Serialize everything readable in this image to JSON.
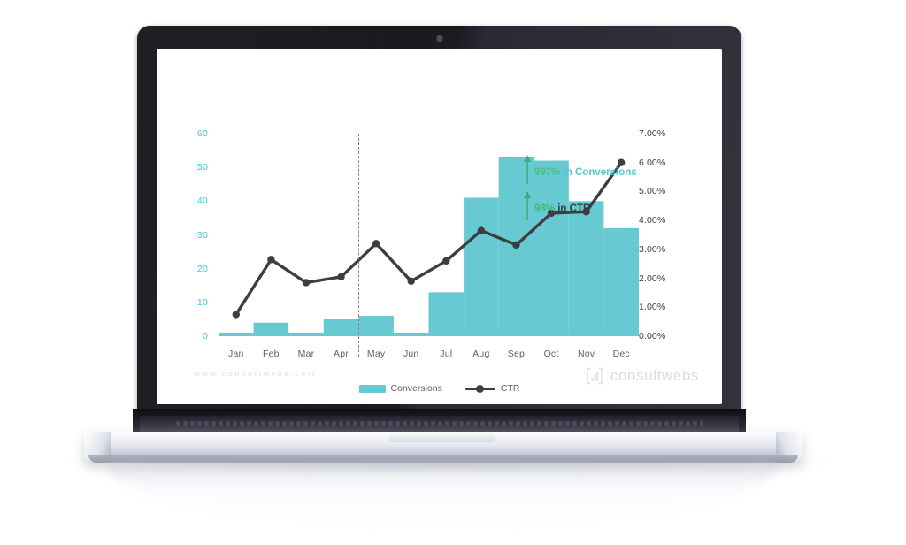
{
  "device": {
    "type": "laptop",
    "webcam": "webcam-dot"
  },
  "screen": {
    "footer_url": "www.consultwebs.com",
    "brand_name": "consultwebs",
    "brand_icon": "bar-chart-logo-icon"
  },
  "annotations": [
    {
      "id": "conversions-callout",
      "icon": "arrow-up-icon",
      "value": "997%",
      "label": "in Conversions",
      "label_color": "#5ac5cf",
      "value_color": "#4cbf7e"
    },
    {
      "id": "ctr-callout",
      "icon": "arrow-up-icon",
      "value": "98%",
      "label": "in CTR",
      "label_color": "#3a3b40",
      "value_color": "#4cbf7e"
    }
  ],
  "chart_data": {
    "type": "bar",
    "title": "",
    "subtitle": "",
    "xlabel": "",
    "ylabel": "",
    "grid": false,
    "legend_position": "bottom",
    "categories": [
      "Jan",
      "Feb",
      "Mar",
      "Apr",
      "May",
      "Jun",
      "Jul",
      "Aug",
      "Sep",
      "Oct",
      "Nov",
      "Dec"
    ],
    "axes": {
      "left": {
        "name": "Conversions",
        "ticks": [
          "0",
          "10",
          "20",
          "30",
          "40",
          "50",
          "60"
        ],
        "values": [
          0,
          10,
          20,
          30,
          40,
          50,
          60
        ],
        "min": 0,
        "max": 60,
        "color": "#46c5cf"
      },
      "right": {
        "name": "CTR",
        "ticks": [
          "0.00%",
          "1.00%",
          "2.00%",
          "3.00%",
          "4.00%",
          "5.00%",
          "6.00%",
          "7.00%"
        ],
        "values": [
          0,
          1,
          2,
          3,
          4,
          5,
          6,
          7
        ],
        "min": 0,
        "max": 7,
        "color": "#3f4045"
      }
    },
    "series": [
      {
        "name": "Conversions",
        "type": "bar",
        "axis": "left",
        "color": "#67c9d2",
        "values": [
          1,
          4,
          1,
          5,
          6,
          1,
          13,
          41,
          53,
          52,
          40,
          32
        ]
      },
      {
        "name": "CTR",
        "type": "line",
        "axis": "right",
        "color": "#3d3e43",
        "values": [
          0.75,
          2.65,
          1.85,
          2.05,
          3.2,
          1.9,
          2.6,
          3.65,
          3.15,
          4.25,
          4.3,
          6.0
        ]
      }
    ],
    "marker_divider": {
      "after_category": "Apr",
      "style": "dashed",
      "color": "#7f8289"
    }
  },
  "legend": [
    {
      "label": "Conversions",
      "marker": "bar-swatch",
      "color": "#67c9d2"
    },
    {
      "label": "CTR",
      "marker": "line-marker",
      "color": "#3d3e43"
    }
  ]
}
